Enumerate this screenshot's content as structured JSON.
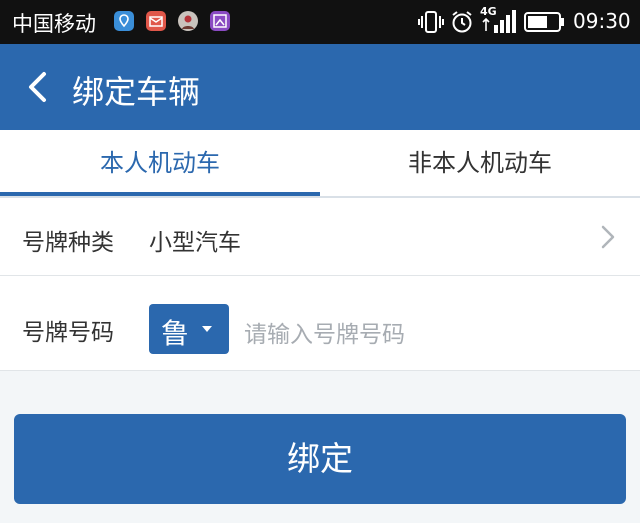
{
  "statusbar": {
    "carrier": "中国移动",
    "network": "4G",
    "time": "09:30",
    "app_icons": [
      "map-pin-icon",
      "mail-icon",
      "avatar-icon",
      "gallery-icon"
    ]
  },
  "header": {
    "title": "绑定车辆"
  },
  "tabs": [
    {
      "label": "本人机动车",
      "active": true
    },
    {
      "label": "非本人机动车",
      "active": false
    }
  ],
  "form": {
    "plate_type": {
      "label": "号牌种类",
      "value": "小型汽车"
    },
    "plate_number": {
      "label": "号牌号码",
      "province": "鲁",
      "placeholder": "请输入号牌号码"
    }
  },
  "actions": {
    "bind_label": "绑定"
  },
  "colors": {
    "primary": "#2b68ae",
    "statusbar": "#111111",
    "page_bg": "#f3f6f8"
  }
}
